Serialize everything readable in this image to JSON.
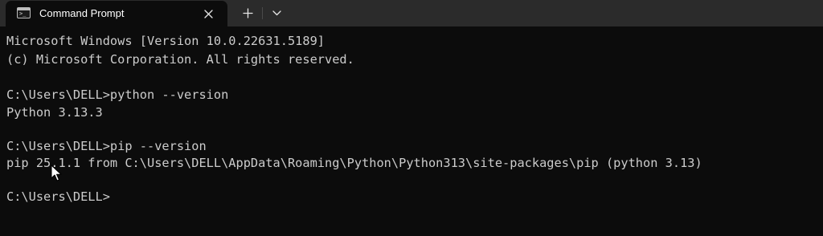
{
  "window": {
    "tab_title": "Command Prompt",
    "tab_icon": "terminal-icon",
    "close_icon": "close-icon",
    "new_tab_icon": "plus-icon",
    "dropdown_icon": "chevron-down-icon"
  },
  "console": {
    "lines": [
      "Microsoft Windows [Version 10.0.22631.5189]",
      "(c) Microsoft Corporation. All rights reserved.",
      "",
      "C:\\Users\\DELL>python --version",
      "Python 3.13.3",
      "",
      "C:\\Users\\DELL>pip --version",
      "pip 25.1.1 from C:\\Users\\DELL\\AppData\\Roaming\\Python\\Python313\\site-packages\\pip (python 3.13)",
      "",
      "C:\\Users\\DELL>"
    ]
  },
  "colors": {
    "background": "#0c0c0c",
    "tabbar": "#2b2b2b",
    "text": "#cccccc"
  }
}
